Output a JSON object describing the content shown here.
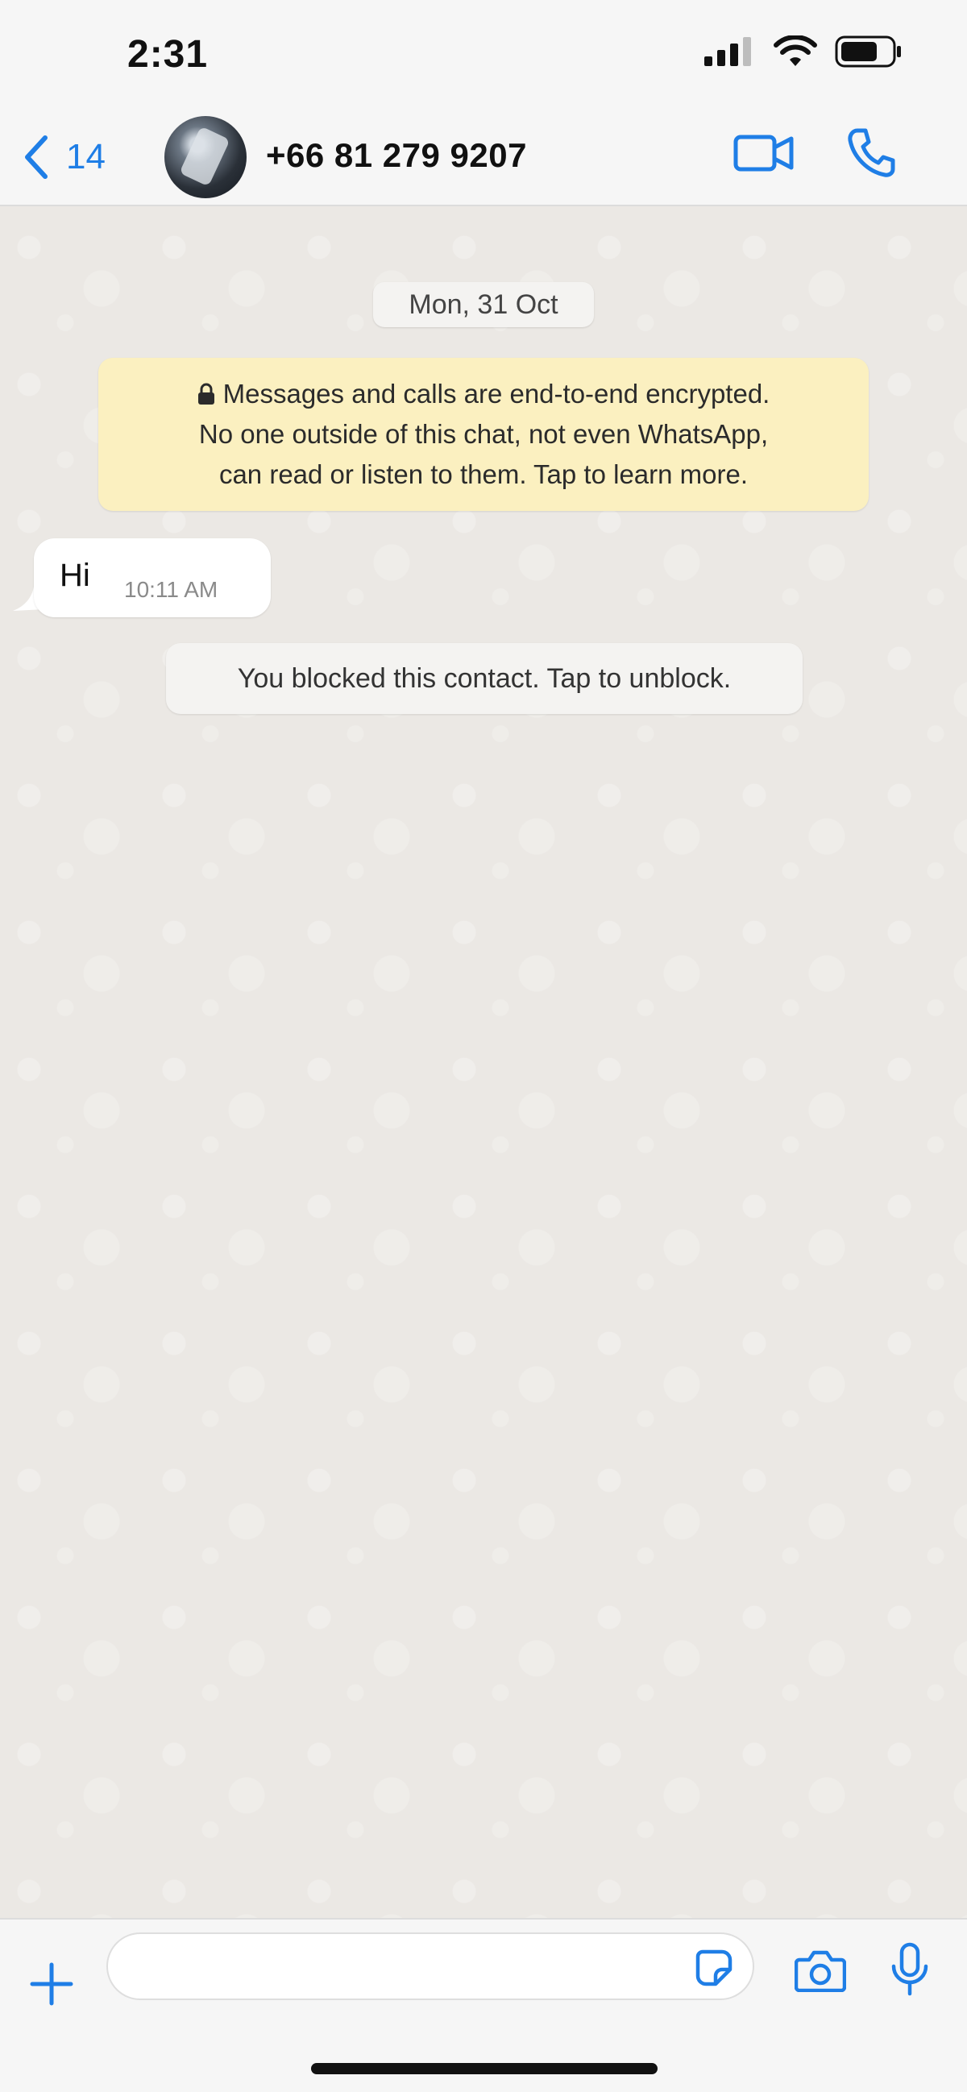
{
  "status_bar": {
    "time": "2:31"
  },
  "header": {
    "back_count": "14",
    "contact_name": "+66 81 279 9207"
  },
  "chat": {
    "date_label": "Mon, 31 Oct",
    "encryption_notice": {
      "line1": "Messages and calls are end-to-end encrypted.",
      "line2": "No one outside of this chat, not even WhatsApp,",
      "line3": "can read or listen to them. Tap to learn more."
    },
    "messages": [
      {
        "direction": "incoming",
        "text": "Hi",
        "time": "10:11 AM"
      }
    ],
    "blocked_notice": "You blocked this contact. Tap to unblock."
  },
  "input_bar": {
    "message_value": "",
    "message_placeholder": ""
  },
  "colors": {
    "accent": "#1f7ee6",
    "chat_background": "#ebe8e4",
    "encryption_bubble": "#fbf0c0",
    "incoming_bubble": "#ffffff"
  },
  "icons": [
    "signal-icon",
    "wifi-icon",
    "battery-icon",
    "chevron-left-icon",
    "video-camera-icon",
    "phone-icon",
    "lock-icon",
    "plus-icon",
    "sticker-icon",
    "camera-icon",
    "microphone-icon"
  ]
}
